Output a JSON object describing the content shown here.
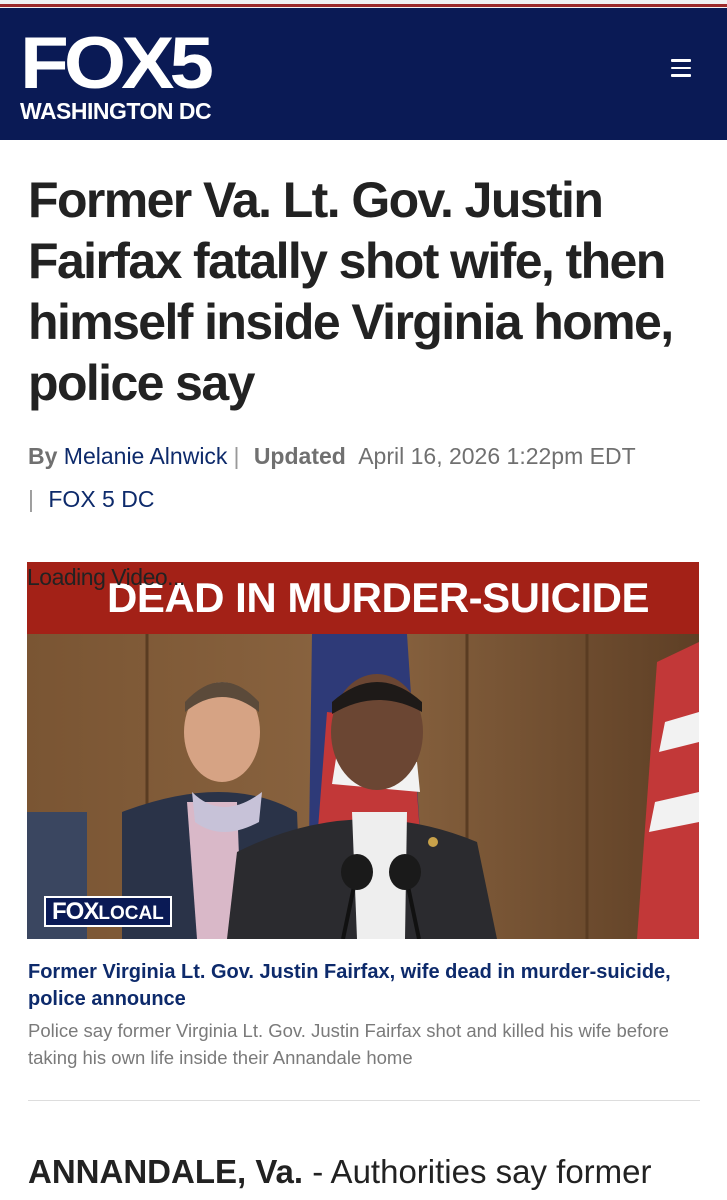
{
  "header": {
    "logo_main": "FOX5",
    "logo_sub": "WASHINGTON DC",
    "menu_icon": "hamburger-menu-icon",
    "background": "#0a1a55"
  },
  "article": {
    "headline": "Former Va. Lt. Gov. Justin Fairfax fatally shot wife, then himself inside Virginia home, police say",
    "byline_prefix": "By",
    "author": "Melanie Alnwick",
    "updated_label": "Updated",
    "updated_time": "April 16, 2026 1:22pm EDT",
    "source": "FOX 5 DC"
  },
  "video": {
    "loading_text": "Loading Video...",
    "banner": "DEAD IN MURDER-SUICIDE",
    "badge_fox": "FOX",
    "badge_local": "LOCAL",
    "banner_color": "#a32117"
  },
  "caption": {
    "title": "Former Virginia Lt. Gov. Justin Fairfax, wife dead in murder-suicide, police announce",
    "description": "Police say former Virginia Lt. Gov. Justin Fairfax shot and killed his wife before taking his own life inside their Annandale home"
  },
  "body": {
    "dateline": "ANNANDALE, Va.",
    "lede": " - Authorities say former"
  }
}
